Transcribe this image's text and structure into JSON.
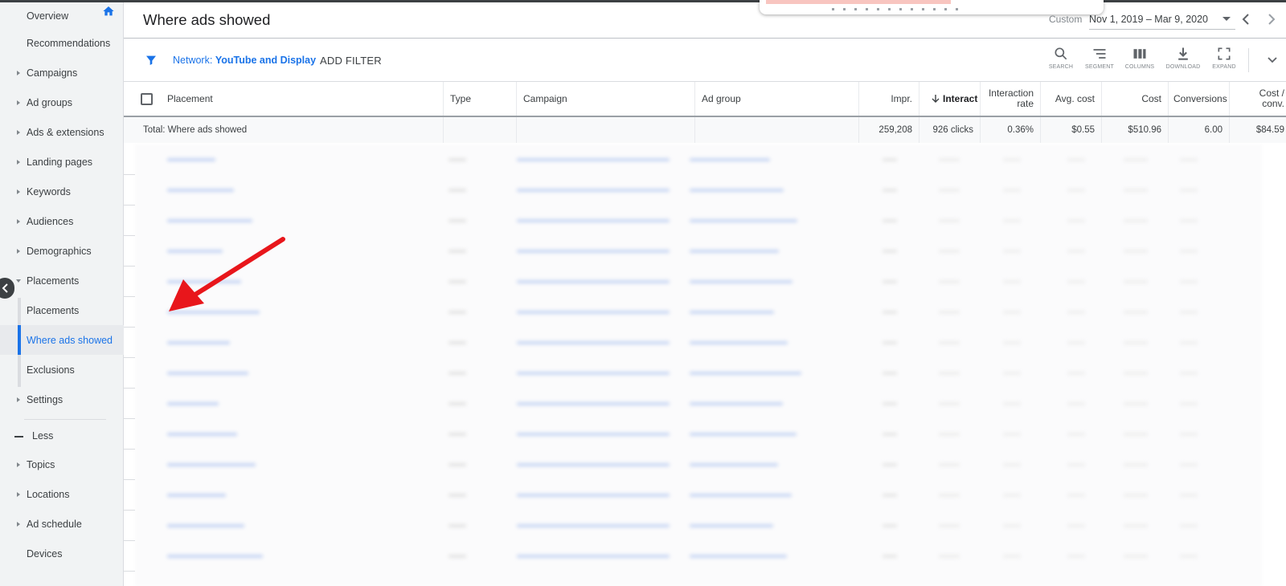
{
  "sidebar": {
    "items": [
      {
        "label": "Overview",
        "caret": "none"
      },
      {
        "label": "Recommendations",
        "caret": "none"
      },
      {
        "label": "Campaigns",
        "caret": "right"
      },
      {
        "label": "Ad groups",
        "caret": "right"
      },
      {
        "label": "Ads & extensions",
        "caret": "right"
      },
      {
        "label": "Landing pages",
        "caret": "right"
      },
      {
        "label": "Keywords",
        "caret": "right"
      },
      {
        "label": "Audiences",
        "caret": "right"
      },
      {
        "label": "Demographics",
        "caret": "right"
      },
      {
        "label": "Placements",
        "caret": "down"
      }
    ],
    "sub_items": [
      {
        "label": "Placements",
        "active": false
      },
      {
        "label": "Where ads showed",
        "active": true
      },
      {
        "label": "Exclusions",
        "active": false
      }
    ],
    "settings_label": "Settings",
    "less_label": "Less",
    "more_items": [
      {
        "label": "Topics",
        "caret": "right"
      },
      {
        "label": "Locations",
        "caret": "right"
      },
      {
        "label": "Ad schedule",
        "caret": "right"
      },
      {
        "label": "Devices",
        "caret": "none"
      }
    ]
  },
  "header": {
    "title": "Where ads showed",
    "date_label": "Custom",
    "date_range": "Nov 1, 2019 – Mar 9, 2020"
  },
  "filter": {
    "network_prefix": "Network:",
    "network_value": "YouTube and Display",
    "add_filter": "ADD FILTER"
  },
  "toolbar": {
    "search": "SEARCH",
    "segment": "SEGMENT",
    "columns": "COLUMNS",
    "download": "DOWNLOAD",
    "expand": "EXPAND"
  },
  "table": {
    "headers": {
      "placement": "Placement",
      "type": "Type",
      "campaign": "Campaign",
      "ad_group": "Ad group",
      "impr": "Impr.",
      "interactions": "Interact",
      "interaction_rate_1": "Interaction",
      "interaction_rate_2": "rate",
      "avg_cost": "Avg. cost",
      "cost": "Cost",
      "conversions": "Conversions",
      "cost_conv_1": "Cost /",
      "cost_conv_2": "conv."
    },
    "total": {
      "label": "Total: Where ads showed",
      "impr": "259,208",
      "interactions": "926 clicks",
      "interaction_rate": "0.36%",
      "avg_cost": "$0.55",
      "cost": "$510.96",
      "conversions": "6.00",
      "cost_conv": "$84.59"
    }
  },
  "colors": {
    "accent": "#1a73e8",
    "annotation_arrow": "#e8161b",
    "sidebar_bg": "#f1f3f4"
  }
}
